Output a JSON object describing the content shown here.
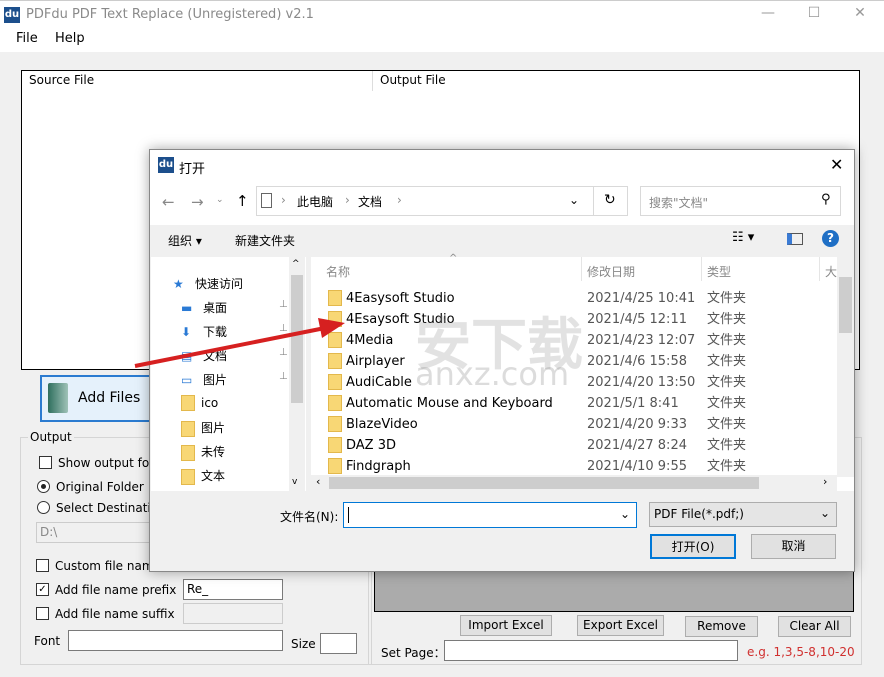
{
  "window": {
    "title": "PDFdu PDF Text Replace (Unregistered) v2.1",
    "logo": "du",
    "minimize": "—",
    "maximize": "☐",
    "close": "✕"
  },
  "menu": [
    "File",
    "Help"
  ],
  "list": {
    "col_source": "Source File",
    "col_output": "Output File"
  },
  "add_files": "Add Files",
  "output": {
    "legend": "Output",
    "show_folder": "Show output fold",
    "original_folder": "Original Folder",
    "select_dest": "Select Destinatio",
    "dest_path": "D:\\",
    "custom_name": "Custom file name",
    "add_prefix": "Add file name prefix",
    "prefix_value": "Re_",
    "prefix_checked": true,
    "add_suffix": "Add file name suffix",
    "font": "Font",
    "size": "Size"
  },
  "actions": {
    "import": "Import Excel",
    "export": "Export Excel",
    "remove": "Remove",
    "clear": "Clear All",
    "set_page": "Set Page：",
    "hint": "e.g. 1,3,5-8,10-20",
    "hint_color": "#d0302f"
  },
  "dialog": {
    "title": "打开",
    "logo": "du",
    "breadcrumb": [
      "此电脑",
      "文档"
    ],
    "search_placeholder": "搜索\"文档\"",
    "organize": "组织 ▾",
    "new_folder": "新建文件夹",
    "nav": [
      {
        "label": "快速访问",
        "icon": "star-icon"
      },
      {
        "label": "桌面",
        "icon": "desktop-icon",
        "pin": true
      },
      {
        "label": "下载",
        "icon": "download-icon",
        "pin": true
      },
      {
        "label": "文档",
        "icon": "document-icon",
        "pin": true
      },
      {
        "label": "图片",
        "icon": "pictures-icon",
        "pin": true
      },
      {
        "label": "ico",
        "icon": "folder-icon"
      },
      {
        "label": "图片",
        "icon": "folder-icon"
      },
      {
        "label": "未传",
        "icon": "folder-icon"
      },
      {
        "label": "文本",
        "icon": "folder-icon"
      }
    ],
    "columns": [
      "名称",
      "修改日期",
      "类型",
      "大"
    ],
    "files": [
      {
        "name": "4Easysoft Studio",
        "date": "2021/4/25 10:41",
        "type": "文件夹"
      },
      {
        "name": "4Esaysoft Studio",
        "date": "2021/4/5 12:11",
        "type": "文件夹"
      },
      {
        "name": "4Media",
        "date": "2021/4/23 12:07",
        "type": "文件夹"
      },
      {
        "name": "Airplayer",
        "date": "2021/4/6 15:58",
        "type": "文件夹"
      },
      {
        "name": "AudiCable",
        "date": "2021/4/20 13:50",
        "type": "文件夹"
      },
      {
        "name": "Automatic Mouse and Keyboard",
        "date": "2021/5/1 8:41",
        "type": "文件夹"
      },
      {
        "name": "BlazeVideo",
        "date": "2021/4/20 9:33",
        "type": "文件夹"
      },
      {
        "name": "DAZ 3D",
        "date": "2021/4/27 8:24",
        "type": "文件夹"
      },
      {
        "name": "Findgraph",
        "date": "2021/4/10 9:55",
        "type": "文件夹"
      }
    ],
    "filename_label": "文件名(N):",
    "filename_value": "",
    "filetype": "PDF File(*.pdf;)",
    "open": "打开(O)",
    "cancel": "取消"
  },
  "watermark": {
    "text": "安下载",
    "sub": "anxz.com"
  },
  "colors": {
    "accent": "#0078d7",
    "arrow": "#d62020"
  }
}
